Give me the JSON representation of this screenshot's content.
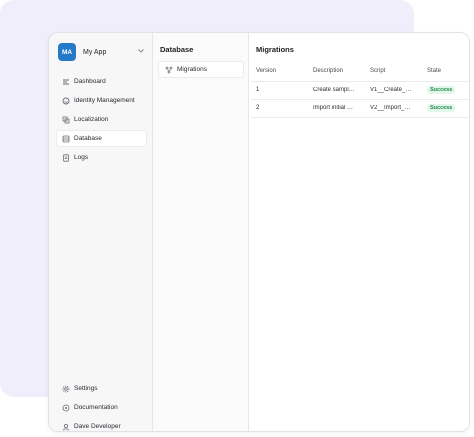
{
  "app": {
    "avatar_initials": "MA",
    "name": "My App",
    "avatar_color": "#2479c9"
  },
  "sidebar": {
    "items": [
      {
        "label": "Dashboard",
        "icon": "dashboard-icon"
      },
      {
        "label": "Identity Management",
        "icon": "identity-icon"
      },
      {
        "label": "Localization",
        "icon": "localization-icon"
      },
      {
        "label": "Database",
        "icon": "database-icon",
        "active": true
      },
      {
        "label": "Logs",
        "icon": "logs-icon"
      }
    ],
    "bottom_items": [
      {
        "label": "Settings",
        "icon": "gear-icon"
      },
      {
        "label": "Documentation",
        "icon": "documentation-icon"
      },
      {
        "label": "Dave Developer",
        "icon": "user-icon"
      }
    ]
  },
  "database": {
    "title": "Database",
    "items": [
      {
        "label": "Migrations",
        "icon": "migrations-icon",
        "active": true
      }
    ]
  },
  "migrations": {
    "title": "Migrations",
    "columns": [
      "Version",
      "Description",
      "Script",
      "State"
    ],
    "rows": [
      {
        "version": "1",
        "description": "Create sampl…",
        "script": "V1__Create_…",
        "state": "Success"
      },
      {
        "version": "2",
        "description": "Import initial …",
        "script": "V2__Import_…",
        "state": "Success"
      }
    ],
    "success_color": "#1f8b4c"
  }
}
